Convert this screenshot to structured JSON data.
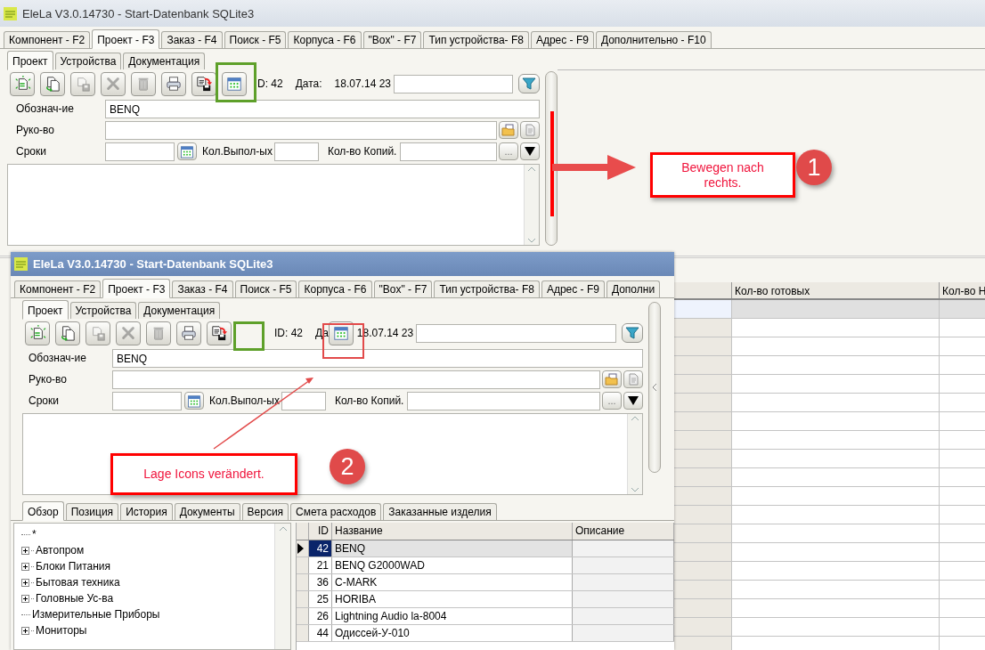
{
  "window": {
    "title": "EleLa V3.0.14730  - Start-Datenbank SQLite3",
    "active": false
  },
  "main_tabs": [
    {
      "label": "Компонент - F2",
      "selected": false
    },
    {
      "label": "Проект - F3",
      "selected": true
    },
    {
      "label": "Заказ - F4",
      "selected": false
    },
    {
      "label": "Поиск - F5",
      "selected": false
    },
    {
      "label": "Корпуса - F6",
      "selected": false
    },
    {
      "label": "\"Box\" - F7",
      "selected": false
    },
    {
      "label": "Тип устройства- F8",
      "selected": false
    },
    {
      "label": "Адрес - F9",
      "selected": false
    },
    {
      "label": "Дополнительно - F10",
      "selected": false
    }
  ],
  "sub_tabs": [
    {
      "label": "Проект",
      "selected": true
    },
    {
      "label": "Устройства",
      "selected": false
    },
    {
      "label": "Документация",
      "selected": false
    }
  ],
  "toolbar": [
    {
      "kind": "new",
      "disabled": false
    },
    {
      "kind": "copy",
      "disabled": false
    },
    {
      "kind": "save",
      "disabled": true
    },
    {
      "kind": "delete",
      "disabled": true
    },
    {
      "kind": "trash",
      "disabled": true
    },
    {
      "kind": "print",
      "disabled": false
    },
    {
      "kind": "export",
      "disabled": false
    },
    {
      "kind": "calendar",
      "disabled": false
    }
  ],
  "record": {
    "id_label": "D: 42",
    "date_label": "Дата:",
    "date_value": "18.07.14 23"
  },
  "form": {
    "designation_label": "Обознач-ие",
    "designation": "BENQ",
    "manager_label": "Руко-во",
    "terms_label": "Сроки",
    "done_label": "Кол.Выпол-ых",
    "copies_label": "Кол-во Копий.",
    "more_button": "..."
  },
  "grid": {
    "columns": [
      "Кол-во готовых",
      "Кол-во Н"
    ],
    "rows": [
      {
        "selected": true
      },
      {
        "selected": false
      },
      {
        "selected": false
      },
      {
        "selected": false
      },
      {
        "selected": false
      },
      {
        "selected": false
      },
      {
        "selected": false
      },
      {
        "selected": false
      },
      {
        "selected": false
      },
      {
        "selected": false
      },
      {
        "selected": false
      },
      {
        "selected": false
      },
      {
        "selected": false
      },
      {
        "selected": false
      },
      {
        "selected": false
      },
      {
        "selected": false
      },
      {
        "selected": false
      },
      {
        "selected": false
      },
      {
        "selected": false
      }
    ]
  },
  "overlay_window": {
    "title": "EleLa V3.0.14730  - Start-Datenbank SQLite3",
    "active": true,
    "main_tabs": [
      {
        "label": "Компонент - F2",
        "selected": false
      },
      {
        "label": "Проект - F3",
        "selected": true
      },
      {
        "label": "Заказ - F4",
        "selected": false
      },
      {
        "label": "Поиск - F5",
        "selected": false
      },
      {
        "label": "Корпуса - F6",
        "selected": false
      },
      {
        "label": "\"Box\" - F7",
        "selected": false
      },
      {
        "label": "Тип устройства- F8",
        "selected": false
      },
      {
        "label": "Адрес - F9",
        "selected": false
      },
      {
        "label": "Дополни",
        "selected": false
      }
    ],
    "sub_tabs": [
      {
        "label": "Проект",
        "selected": true
      },
      {
        "label": "Устройства",
        "selected": false
      },
      {
        "label": "Документация",
        "selected": false
      }
    ],
    "toolbar": [
      {
        "kind": "new",
        "disabled": false
      },
      {
        "kind": "copy",
        "disabled": false
      },
      {
        "kind": "save",
        "disabled": true
      },
      {
        "kind": "delete",
        "disabled": true
      },
      {
        "kind": "trash",
        "disabled": true
      },
      {
        "kind": "print",
        "disabled": false
      },
      {
        "kind": "export",
        "disabled": false
      }
    ],
    "record": {
      "id_label": "ID: 42",
      "date_label": "Да",
      "date_button": {
        "kind": "calendar",
        "disabled": false
      },
      "date_value": "18.07.14 23"
    },
    "form": {
      "designation_label": "Обознач-ие",
      "designation": "BENQ",
      "manager_label": "Руко-во",
      "terms_label": "Сроки",
      "done_label": "Кол.Выпол-ых",
      "copies_label": "Кол-во Копий.",
      "more_button": "..."
    },
    "bottom_tabs": [
      {
        "label": "Обзор",
        "selected": true
      },
      {
        "label": "Позиция",
        "selected": false
      },
      {
        "label": "История",
        "selected": false
      },
      {
        "label": "Документы",
        "selected": false
      },
      {
        "label": "Версия",
        "selected": false
      },
      {
        "label": "Смета расходов",
        "selected": false
      },
      {
        "label": "Заказанные изделия",
        "selected": false
      }
    ],
    "tree": [
      {
        "label": "*",
        "expandable": false
      },
      {
        "label": "Автопром",
        "expandable": true
      },
      {
        "label": "Блоки Питания",
        "expandable": true
      },
      {
        "label": "Бытовая техника",
        "expandable": true
      },
      {
        "label": "Головные Ус-ва",
        "expandable": true
      },
      {
        "label": "Измерительные Приборы",
        "expandable": false
      },
      {
        "label": "Мониторы",
        "expandable": true
      }
    ],
    "table": {
      "columns": [
        "ID",
        "Название",
        "Описание"
      ],
      "rows": [
        {
          "id": "42",
          "name": "BENQ",
          "selected": true
        },
        {
          "id": "21",
          "name": "BENQ G2000WAD",
          "selected": false
        },
        {
          "id": "36",
          "name": "C-MARK",
          "selected": false
        },
        {
          "id": "25",
          "name": "HORIBA",
          "selected": false
        },
        {
          "id": "26",
          "name": "Lightning Audio la-8004",
          "selected": false
        },
        {
          "id": "44",
          "name": "Одиссей-У-010",
          "selected": false
        }
      ]
    }
  },
  "annotations": [
    {
      "kind": "callout",
      "text": "Bewegen nach rechts.",
      "number": "1"
    },
    {
      "kind": "callout",
      "text": "Lage Icons verändert.",
      "number": "2"
    }
  ]
}
